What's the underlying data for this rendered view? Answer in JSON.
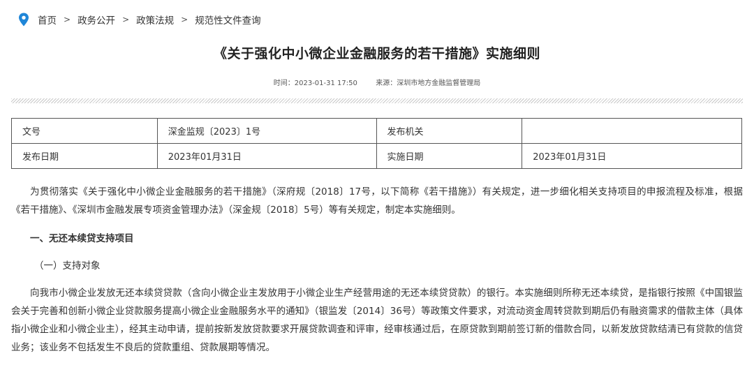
{
  "breadcrumb": {
    "items": [
      "首页",
      "政务公开",
      "政策法规",
      "规范性文件查询"
    ],
    "separator": ">"
  },
  "article": {
    "title": "《关于强化中小微企业金融服务的若干措施》实施细则",
    "meta": {
      "time_label": "时间：",
      "time_value": "2023-01-31 17:50",
      "source_label": "来源：",
      "source_value": "深圳市地方金融监督管理局"
    }
  },
  "info_table": {
    "rows": [
      [
        "文号",
        "深金监规〔2023〕1号",
        "发布机关",
        ""
      ],
      [
        "发布日期",
        "2023年01月31日",
        "实施日期",
        "2023年01月31日"
      ]
    ]
  },
  "content": {
    "intro": "为贯彻落实《关于强化中小微企业金融服务的若干措施》（深府规〔2018〕17号，以下简称《若干措施》）有关规定，进一步细化相关支持项目的申报流程及标准，根据《若干措施》、《深圳市金融发展专项资金管理办法》（深金规〔2018〕5号）等有关规定，制定本实施细则。",
    "section1_heading": "一、无还本续贷支持项目",
    "subsection1_heading": "（一）支持对象",
    "subsection1_body": "向我市小微企业发放无还本续贷贷款（含向小微企业主发放用于小微企业生产经营用途的无还本续贷贷款）的银行。本实施细则所称无还本续贷，是指银行按照《中国银监会关于完善和创新小微企业贷款服务提高小微企业金融服务水平的通知》（银监发〔2014〕36号）等政策文件要求，对流动资金周转贷款到期后仍有融资需求的借款主体（具体指小微企业和小微企业主），经其主动申请，提前按新发放贷款要求开展贷款调查和评审，经审核通过后，在原贷款到期前签订新的借款合同，以新发放贷款结清已有贷款的信贷业务；该业务不包括发生不良后的贷款重组、贷款展期等情况。"
  },
  "colors": {
    "pin_icon": "#1f86d8",
    "border": "#555555",
    "text": "#333333"
  }
}
